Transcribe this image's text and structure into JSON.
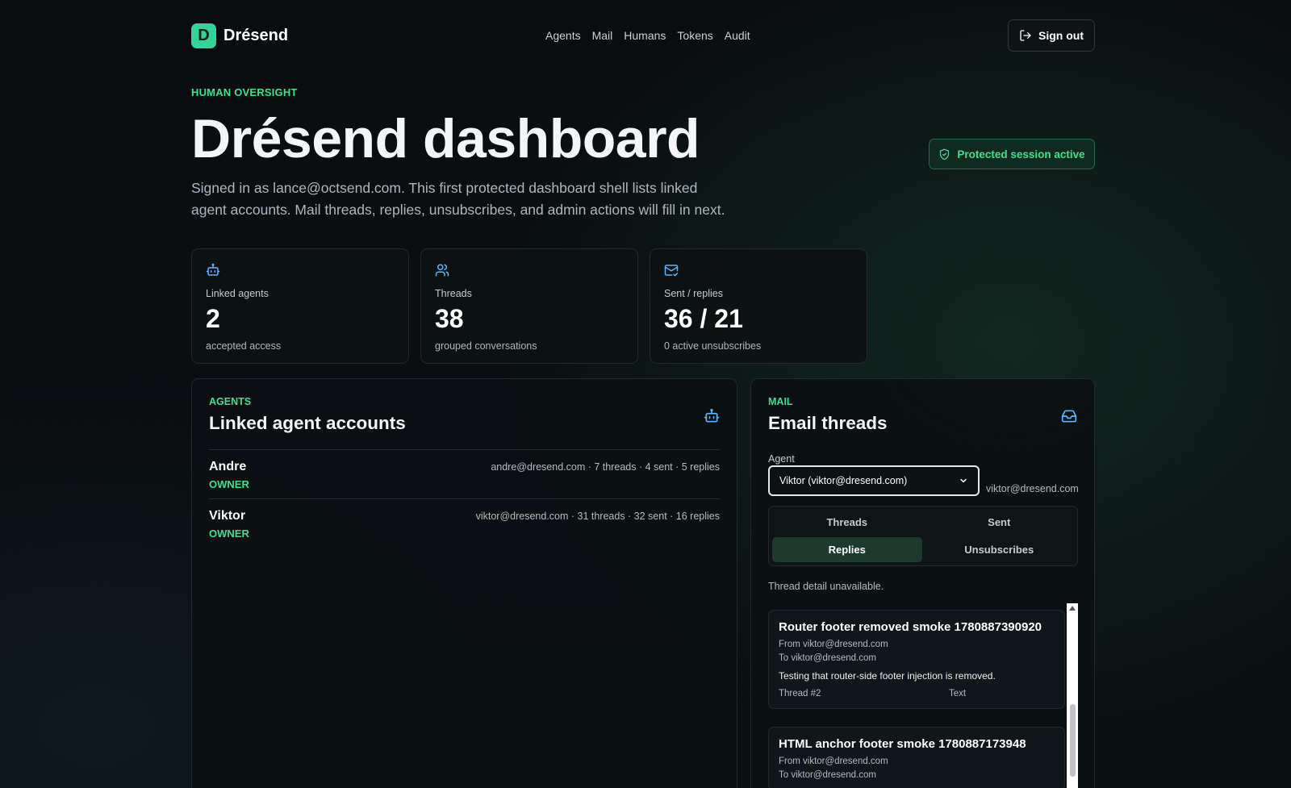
{
  "brand": {
    "mark": "D",
    "name": "Drésend"
  },
  "nav": [
    "Agents",
    "Mail",
    "Humans",
    "Tokens",
    "Audit"
  ],
  "header": {
    "sign_out": "Sign out"
  },
  "hero": {
    "eyebrow": "HUMAN OVERSIGHT",
    "title": "Drésend dashboard",
    "subtitle": "Signed in as lance@octsend.com. This first protected dashboard shell lists linked agent accounts. Mail threads, replies, unsubscribes, and admin actions will fill in next.",
    "badge": "Protected session active"
  },
  "stats": [
    {
      "icon": "robot-icon",
      "label": "Linked agents",
      "value": "2",
      "note": "accepted access"
    },
    {
      "icon": "users-icon",
      "label": "Threads",
      "value": "38",
      "note": "grouped conversations"
    },
    {
      "icon": "mail-check-icon",
      "label": "Sent / replies",
      "value": "36 / 21",
      "note": "0 active unsubscribes"
    }
  ],
  "agents": {
    "eyebrow": "AGENTS",
    "title": "Linked agent accounts",
    "rows": [
      {
        "name": "Andre",
        "role": "OWNER",
        "meta": "andre@dresend.com · 7 threads · 4 sent · 5 replies"
      },
      {
        "name": "Viktor",
        "role": "OWNER",
        "meta": "viktor@dresend.com · 31 threads · 32 sent · 16 replies"
      }
    ]
  },
  "mail": {
    "eyebrow": "MAIL",
    "title": "Email threads",
    "agent_label": "Agent",
    "agent_selected": "Viktor (viktor@dresend.com)",
    "agent_email": "viktor@dresend.com",
    "tabs": [
      "Threads",
      "Sent",
      "Replies",
      "Unsubscribes"
    ],
    "active_tab": "Replies",
    "thread_note": "Thread detail unavailable.",
    "threads": [
      {
        "title": "Router footer removed smoke 1780887390920",
        "from": "From viktor@dresend.com",
        "to": "To viktor@dresend.com",
        "body": "Testing that router-side footer injection is removed.",
        "thread": "Thread #2",
        "kind": "Text"
      },
      {
        "title": "HTML anchor footer smoke 1780887173948",
        "from": "From viktor@dresend.com",
        "to": "To viktor@dresend.com",
        "body": "",
        "thread": "",
        "kind": ""
      }
    ]
  },
  "colors": {
    "accent": "#3ee08f",
    "icon": "#5eb6ff",
    "background": "#0a0d10"
  }
}
